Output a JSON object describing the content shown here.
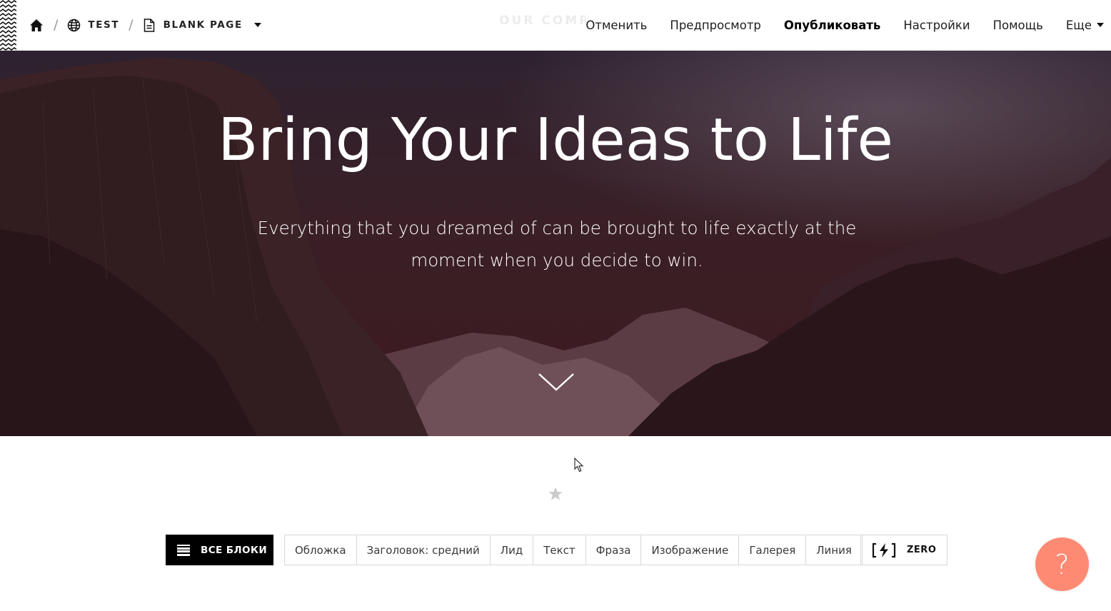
{
  "breadcrumb": {
    "site_label": "TEST",
    "page_label": "BLANK PAGE",
    "icons": [
      "home-icon",
      "globe-icon",
      "page-icon",
      "caret-down-icon"
    ]
  },
  "ghost_logo": "OUR COMPAN",
  "menu": {
    "cancel": "Отменить",
    "preview": "Предпросмотр",
    "publish": "Опубликовать",
    "settings": "Настройки",
    "help": "Помощь",
    "more": "Еще"
  },
  "hero": {
    "title": "Bring Your Ideas to Life",
    "subtitle": "Everything that you dreamed of can be brought to life exactly at the moment when you decide to win."
  },
  "toolbar": {
    "all_blocks": "ВСЕ БЛОКИ",
    "block_types": [
      "Обложка",
      "Заголовок: средний",
      "Лид",
      "Текст",
      "Фраза",
      "Изображение",
      "Галерея",
      "Линия"
    ],
    "zero": "ZERO",
    "help_symbol": "?"
  },
  "colors": {
    "help_button": "#ff8a73",
    "hero_overlay": "#3a1a22",
    "all_blocks_bg": "#000000"
  }
}
